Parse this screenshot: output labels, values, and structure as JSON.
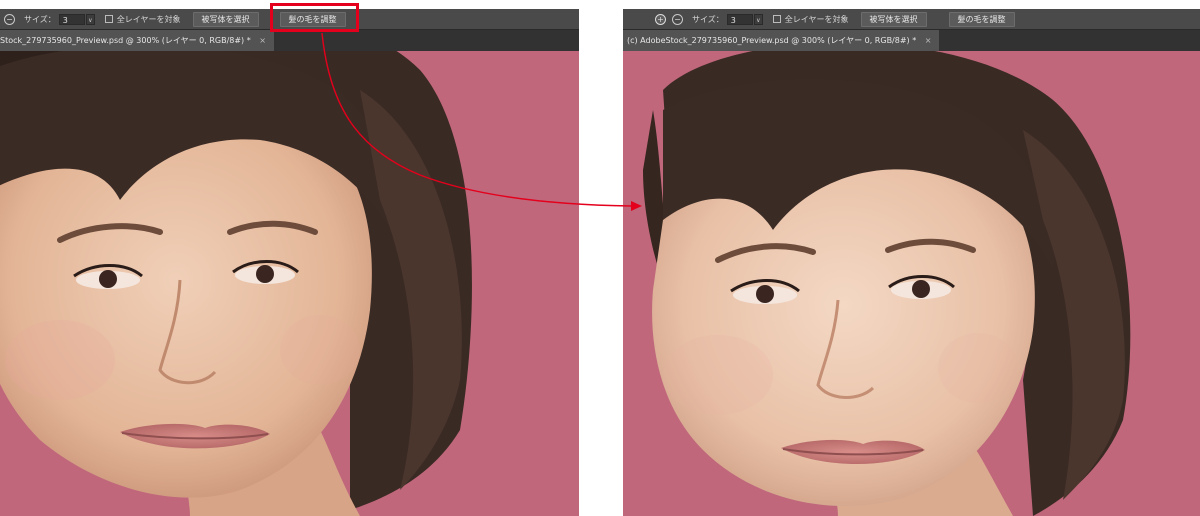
{
  "options_bar": {
    "size_label": "サイズ：",
    "size_value": "3",
    "size_dropdown": "∨",
    "sample_all_layers_label": "全レイヤーを対象",
    "select_subject_label": "被写体を選択",
    "refine_hair_label": "髪の毛を調整"
  },
  "left_panel": {
    "tab_title": "Stock_279735960_Preview.psd @ 300% (レイヤー 0, RGB/8#) *",
    "tab_close": "×"
  },
  "right_panel": {
    "tab_title": "(c) AdobeStock_279735960_Preview.psd @ 300% (レイヤー 0, RGB/8#) *",
    "tab_close": "×"
  },
  "icons": {
    "add": "+",
    "subtract": "−"
  },
  "colors": {
    "background_pink": "#c0677c",
    "highlight_red": "#e4001c",
    "options_bar": "#4a4a4a",
    "tab_bar": "#323232"
  }
}
